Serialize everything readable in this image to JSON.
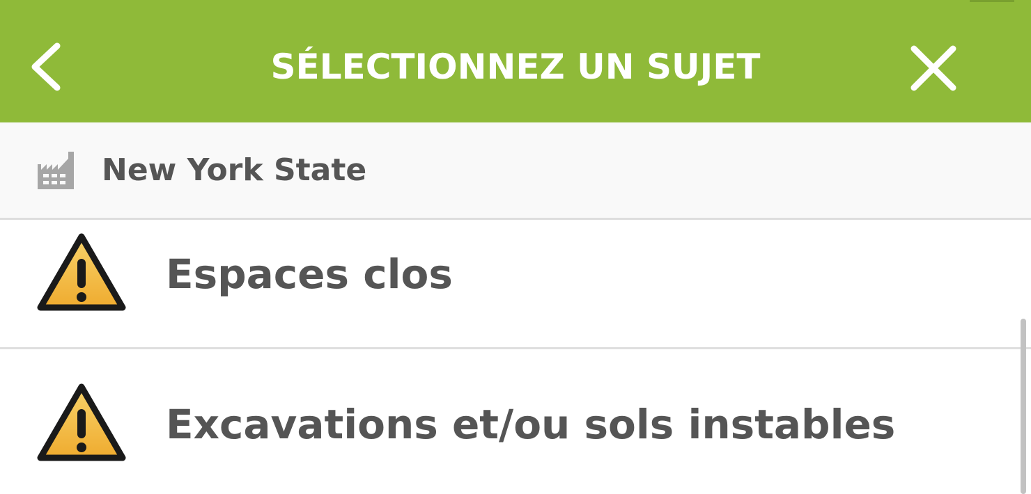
{
  "header": {
    "title": "SÉLECTIONNEZ UN SUJET",
    "back_icon": "chevron-left-icon",
    "close_icon": "close-icon",
    "background_color": "#8fba39"
  },
  "site": {
    "icon": "factory-icon",
    "name": "New York State"
  },
  "topics": [
    {
      "icon": "warning-icon",
      "label": "Espaces clos"
    },
    {
      "icon": "warning-icon",
      "label": "Excavations et/ou sols instables"
    }
  ],
  "colors": {
    "accent": "#8fba39",
    "text": "#555555",
    "warning_fill": "#f2bb42",
    "warning_outline": "#1a1a1a"
  }
}
